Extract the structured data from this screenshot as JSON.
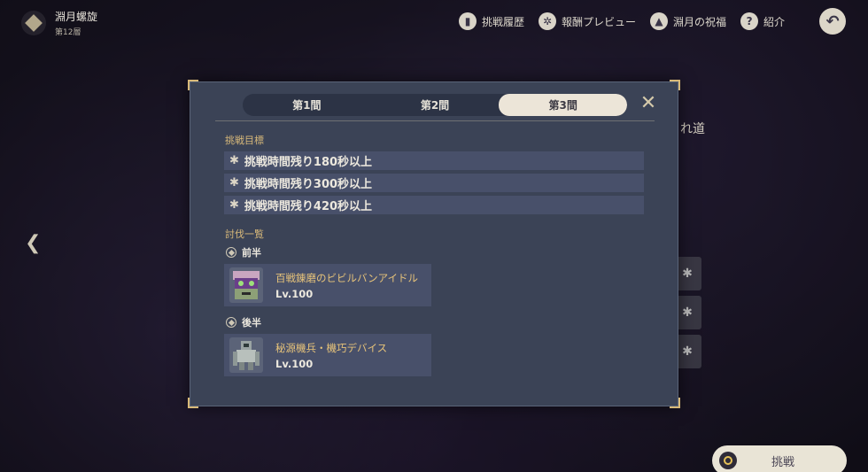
{
  "header": {
    "title": "淵月螺旋",
    "floor": "第12層"
  },
  "topnav": [
    {
      "label": "挑戦履歴",
      "icon": "book-icon"
    },
    {
      "label": "報酬プレビュー",
      "icon": "gear-star-icon"
    },
    {
      "label": "淵月の祝福",
      "icon": "blessing-icon"
    },
    {
      "label": "紹介",
      "icon": "help-icon"
    }
  ],
  "background": {
    "partial_text": "れ道"
  },
  "modal": {
    "tabs": [
      {
        "label": "第1間",
        "active": false
      },
      {
        "label": "第2間",
        "active": false
      },
      {
        "label": "第3間",
        "active": true
      }
    ],
    "goals_title": "挑戦目標",
    "goals": [
      "挑戦時間残り180秒以上",
      "挑戦時間残り300秒以上",
      "挑戦時間残り420秒以上"
    ],
    "enemies_title": "討伐一覧",
    "first_half": {
      "label": "前半",
      "enemy_name": "百戦錬磨のビビルバンアイドル",
      "enemy_level": "Lv.100"
    },
    "second_half": {
      "label": "後半",
      "enemy_name": "秘源機兵・機巧デバイス",
      "enemy_level": "Lv.100"
    }
  },
  "challenge_button": {
    "label": "挑戦"
  },
  "colors": {
    "accent_gold": "#d8b97a",
    "panel": "#3b4356",
    "row": "#48506a",
    "active_tab": "#ece5d8"
  }
}
